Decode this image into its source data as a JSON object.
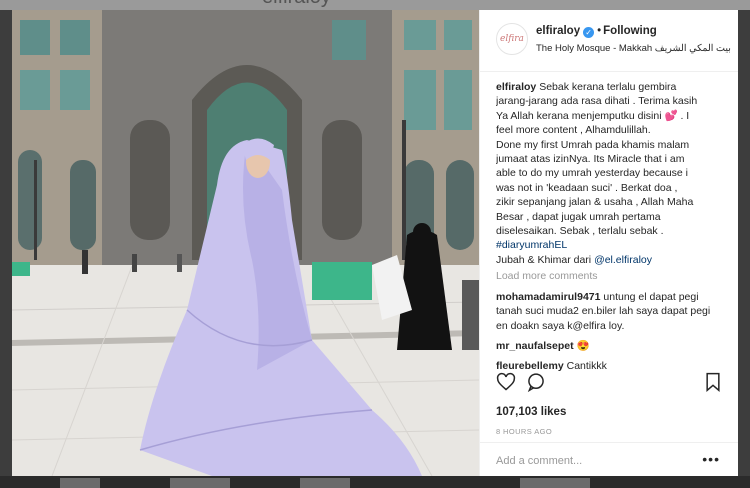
{
  "backdrop": {
    "profile_title": "elfiraloy"
  },
  "post": {
    "username": "elfiraloy",
    "follow_state": "Following",
    "location": "The Holy Mosque - Makkah بيت المكي الشريف",
    "caption_lines": [
      "Sebak kerana terlalu gembira",
      "jarang-jarang ada rasa dihati . Terima kasih",
      "Ya Allah kerana menjemputku disini 💕 . I",
      "feel more content , Alhamdulillah.",
      "Done my first Umrah pada khamis malam",
      "jumaat atas izinNya. Its Miracle that i am",
      "able to do my umrah yesterday because i",
      "was not in 'keadaan suci' . Berkat doa ,",
      "zikir sepanjang jalan & usaha , Allah Maha",
      "Besar , dapat jugak umrah pertama",
      "diselesaikan. Sebak , terlalu sebak ."
    ],
    "hashtag": "#diaryumrahEL",
    "credit_text": "Jubah & Khimar dari",
    "credit_mention": "@el.elfiraloy",
    "load_more": "Load more comments",
    "comments": [
      {
        "user": "mohamadamirul9471",
        "text": "untung el dapat pegi tanah suci muda2 en.biler lah saya dapat pegi en doakn saya k@elfira loy."
      },
      {
        "user": "mr_naufalsepet",
        "text": "😍"
      },
      {
        "user": "fleurebellemy",
        "text": "Cantikkk"
      }
    ],
    "likes": "107,103 likes",
    "time_ago": "8 HOURS AGO",
    "add_comment_placeholder": "Add a comment...",
    "more_options": "•••"
  },
  "icons": [
    "heart-icon",
    "comment-icon",
    "bookmark-icon",
    "verified-badge-icon",
    "more-options-icon"
  ],
  "colors": {
    "link": "#003569",
    "verified": "#3897f0",
    "muted": "#999999",
    "dress": "#c9c3ee"
  }
}
